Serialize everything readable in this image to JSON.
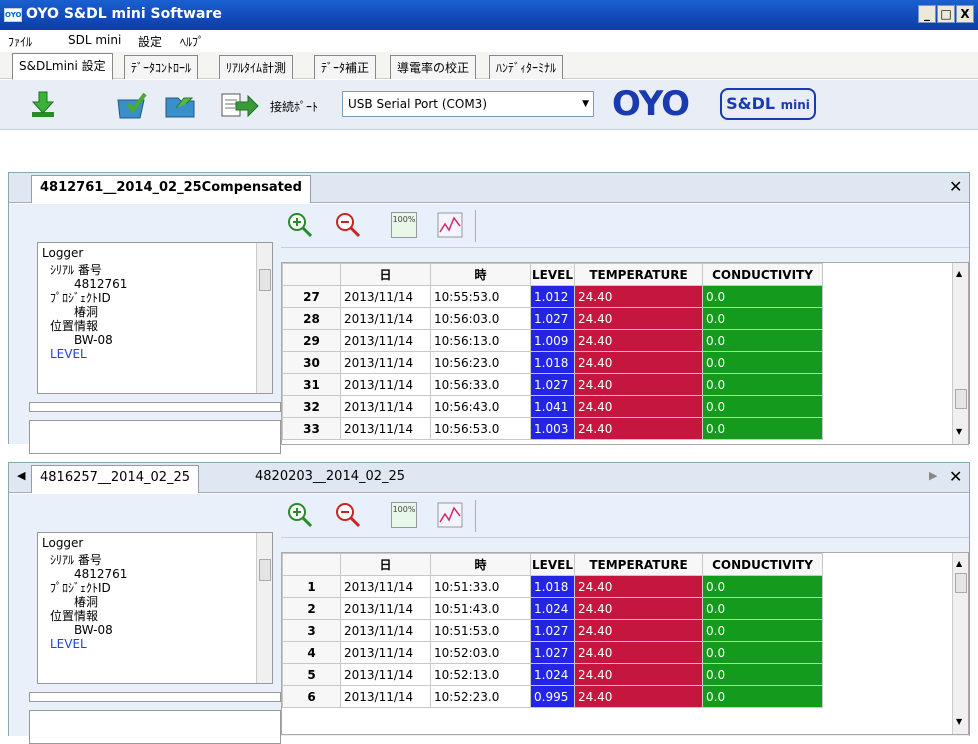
{
  "window": {
    "title": "OYO S&DL mini Software",
    "logo": "OYO",
    "controls": [
      "_",
      "□",
      "X"
    ]
  },
  "menubar": [
    "ﾌｧｲﾙ",
    "SDL mini",
    "設定",
    "ﾍﾙﾌﾟ"
  ],
  "tabs": [
    "S&DLmini 設定",
    "ﾃﾞｰﾀｺﾝﾄﾛｰﾙ",
    "ﾘｱﾙﾀｲﾑ計測",
    "ﾃﾞｰﾀ補正",
    "導電率の校正",
    "ﾊﾝﾃﾞｨﾀｰﾐﾅﾙ"
  ],
  "toolbar": {
    "icons": [
      "download-icon",
      "check-folder-icon",
      "folder-open-icon",
      "export-icon"
    ],
    "port_label": "接続ﾎﾟｰﾄ",
    "port_value": "USB Serial Port (COM3)",
    "brand": "OYO",
    "product_line1": "S&DL",
    "product_line2": "mini"
  },
  "panel1": {
    "tabs": [
      {
        "label": "4812761__2014_02_25Compensated"
      }
    ],
    "tree": {
      "root": "Logger",
      "serial_label": "ｼﾘｱﾙ 番号",
      "serial": "4812761",
      "project_label": "ﾌﾟﾛｼﾞｪｸﾄID",
      "project": "椿洞",
      "location_label": "位置情報",
      "location": "BW-08",
      "next": "LEVEL"
    },
    "columns": [
      "",
      "日",
      "時",
      "LEVEL",
      "TEMPERATURE",
      "CONDUCTIVITY"
    ],
    "rows": [
      [
        "27",
        "2013/11/14",
        "10:55:53.0",
        "1.012",
        "24.40",
        "0.0"
      ],
      [
        "28",
        "2013/11/14",
        "10:56:03.0",
        "1.027",
        "24.40",
        "0.0"
      ],
      [
        "29",
        "2013/11/14",
        "10:56:13.0",
        "1.009",
        "24.40",
        "0.0"
      ],
      [
        "30",
        "2013/11/14",
        "10:56:23.0",
        "1.018",
        "24.40",
        "0.0"
      ],
      [
        "31",
        "2013/11/14",
        "10:56:33.0",
        "1.027",
        "24.40",
        "0.0"
      ],
      [
        "32",
        "2013/11/14",
        "10:56:43.0",
        "1.041",
        "24.40",
        "0.0"
      ],
      [
        "33",
        "2013/11/14",
        "10:56:53.0",
        "1.003",
        "24.40",
        "0.0"
      ]
    ]
  },
  "panel2": {
    "tabs": [
      {
        "label": "4816257__2014_02_25"
      },
      {
        "label": "4820203__2014_02_25"
      }
    ],
    "tree": {
      "root": "Logger",
      "serial_label": "ｼﾘｱﾙ 番号",
      "serial": "4812761",
      "project_label": "ﾌﾟﾛｼﾞｪｸﾄID",
      "project": "椿洞",
      "location_label": "位置情報",
      "location": "BW-08",
      "next": "LEVEL"
    },
    "columns": [
      "",
      "日",
      "時",
      "LEVEL",
      "TEMPERATURE",
      "CONDUCTIVITY"
    ],
    "rows": [
      [
        "1",
        "2013/11/14",
        "10:51:33.0",
        "1.018",
        "24.40",
        "0.0"
      ],
      [
        "2",
        "2013/11/14",
        "10:51:43.0",
        "1.024",
        "24.40",
        "0.0"
      ],
      [
        "3",
        "2013/11/14",
        "10:51:53.0",
        "1.027",
        "24.40",
        "0.0"
      ],
      [
        "4",
        "2013/11/14",
        "10:52:03.0",
        "1.027",
        "24.40",
        "0.0"
      ],
      [
        "5",
        "2013/11/14",
        "10:52:13.0",
        "1.024",
        "24.40",
        "0.0"
      ],
      [
        "6",
        "2013/11/14",
        "10:52:23.0",
        "0.995",
        "24.40",
        "0.0"
      ]
    ]
  },
  "icons": {
    "zoom_in": "zoom-in-icon",
    "zoom_out": "zoom-out-icon",
    "zoom_100": "100%",
    "chart": "chart-icon"
  },
  "colors": {
    "level": "#2424e6",
    "temperature": "#c4163e",
    "conductivity": "#149a1c",
    "titlebar": "#0b3da6"
  }
}
